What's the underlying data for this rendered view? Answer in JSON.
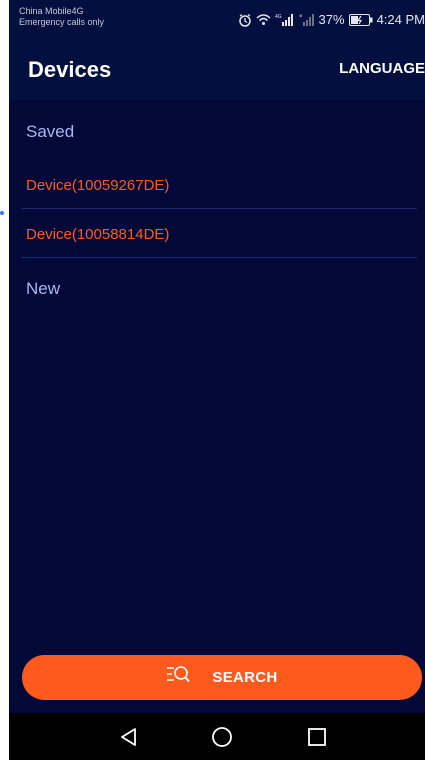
{
  "status_bar": {
    "carrier": "China Mobile4G",
    "emergency": "Emergency calls only",
    "network": "4G",
    "battery": "37%",
    "time": "4:24 PM"
  },
  "header": {
    "title": "Devices",
    "language_button": "LANGUAGE"
  },
  "sections": {
    "saved_label": "Saved",
    "new_label": "New"
  },
  "saved_devices": [
    {
      "name": "Device(10059267DE)"
    },
    {
      "name": "Device(10058814DE)"
    }
  ],
  "search_button": {
    "label": "SEARCH",
    "icon": "list-search-icon"
  },
  "navigation": {
    "back_icon": "back-triangle-icon",
    "home_icon": "home-circle-icon",
    "recents_icon": "recents-square-icon"
  },
  "colors": {
    "background": "#020838",
    "accent": "#ff5a1e",
    "section_text": "#a8b7f0",
    "divider": "#1b2a78"
  }
}
